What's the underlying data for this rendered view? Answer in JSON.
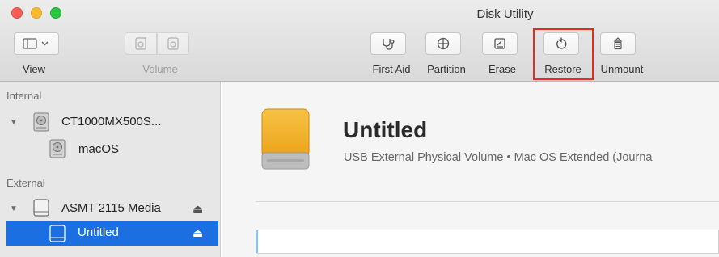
{
  "window": {
    "title": "Disk Utility"
  },
  "toolbar": {
    "view_label": "View",
    "volume_label": "Volume",
    "first_aid_label": "First Aid",
    "partition_label": "Partition",
    "erase_label": "Erase",
    "restore_label": "Restore",
    "unmount_label": "Unmount",
    "highlighted_button": "Restore",
    "highlight_color": "#e32b1f"
  },
  "sidebar": {
    "internal_header": "Internal",
    "external_header": "External",
    "internal_disk": {
      "name": "CT1000MX500S...",
      "volumes": [
        {
          "name": "macOS"
        }
      ]
    },
    "external_disk": {
      "name": "ASMT 2115 Media",
      "eject_symbol": "⏏",
      "volumes": [
        {
          "name": "Untitled",
          "selected": true,
          "eject_symbol": "⏏"
        }
      ]
    },
    "selection_color": "#1b6fe0"
  },
  "main": {
    "volume_name": "Untitled",
    "volume_description": "USB External Physical Volume • Mac OS Extended (Journa",
    "volume_icon_color": "#f0a81e"
  }
}
